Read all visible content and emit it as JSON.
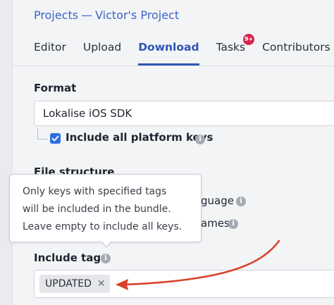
{
  "breadcrumb": {
    "root": "Projects",
    "separator": "—",
    "project": "Victor's Project"
  },
  "tabs": [
    {
      "label": "Editor",
      "active": false
    },
    {
      "label": "Upload",
      "active": false
    },
    {
      "label": "Download",
      "active": true
    },
    {
      "label": "Tasks",
      "active": false,
      "badge": "9+"
    },
    {
      "label": "Contributors",
      "active": false
    }
  ],
  "format": {
    "label": "Format",
    "selected": "Lokalise iOS SDK",
    "include_all_platform_keys": {
      "label": "Include all platform keys",
      "checked": true
    }
  },
  "file_structure": {
    "label": "File structure",
    "option_1_visible_text": "guage",
    "option_2_visible_text": "ames"
  },
  "tooltip": {
    "lines": [
      "Only keys with specified tags",
      "will be included in the bundle.",
      "Leave empty to include all keys."
    ]
  },
  "include_tags": {
    "label": "Include tags",
    "tags": [
      "UPDATED"
    ],
    "remove_glyph": "✕"
  },
  "icons": {
    "info": "info-icon",
    "check": "check-icon",
    "tag_remove": "close-icon",
    "annotation": "red-arrow-annotation"
  },
  "colors": {
    "accent": "#2f55b8",
    "link": "#3b63c7",
    "badge": "#d6254d",
    "checkbox": "#2f6fe0",
    "annotation": "#d9432e"
  }
}
